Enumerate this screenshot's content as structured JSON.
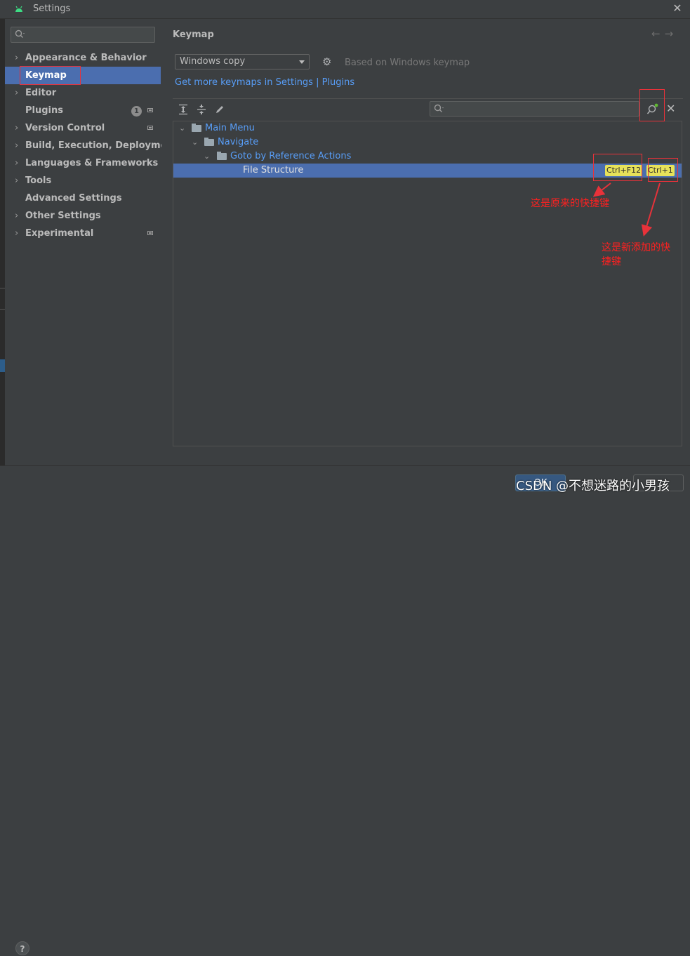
{
  "window": {
    "title": "Settings"
  },
  "sidebar": {
    "items": [
      {
        "label": "Appearance & Behavior",
        "chevron": true
      },
      {
        "label": "Keymap",
        "selected": true
      },
      {
        "label": "Editor",
        "chevron": true
      },
      {
        "label": "Plugins",
        "badge": "1"
      },
      {
        "label": "Version Control",
        "chevron": true
      },
      {
        "label": "Build, Execution, Deployment",
        "chevron": true
      },
      {
        "label": "Languages & Frameworks",
        "chevron": true
      },
      {
        "label": "Tools",
        "chevron": true
      },
      {
        "label": "Advanced Settings"
      },
      {
        "label": "Other Settings",
        "chevron": true
      },
      {
        "label": "Experimental",
        "chevron": true
      }
    ]
  },
  "main": {
    "title": "Keymap",
    "keymap_select": "Windows copy",
    "based_on": "Based on Windows keymap",
    "links": "Get more keymaps in Settings | Plugins",
    "tree": {
      "main_menu": "Main Menu",
      "navigate": "Navigate",
      "goto_ref": "Goto by Reference Actions",
      "file_structure": "File Structure",
      "shortcut_original": "Ctrl+F12",
      "shortcut_added": "Ctrl+1"
    }
  },
  "annotations": {
    "original": "这是原来的快捷键",
    "added_line1": "这是新添加的快",
    "added_line2": "捷键"
  },
  "footer": {
    "ok": "OK",
    "help": "?",
    "watermark": "CSDN @不想迷路的小男孩"
  },
  "colors": {
    "background": "#3c3f41",
    "selection": "#4b6eaf",
    "link": "#589df6",
    "shortcut_bg": "#e6e25a",
    "annotation": "#e8323a"
  }
}
